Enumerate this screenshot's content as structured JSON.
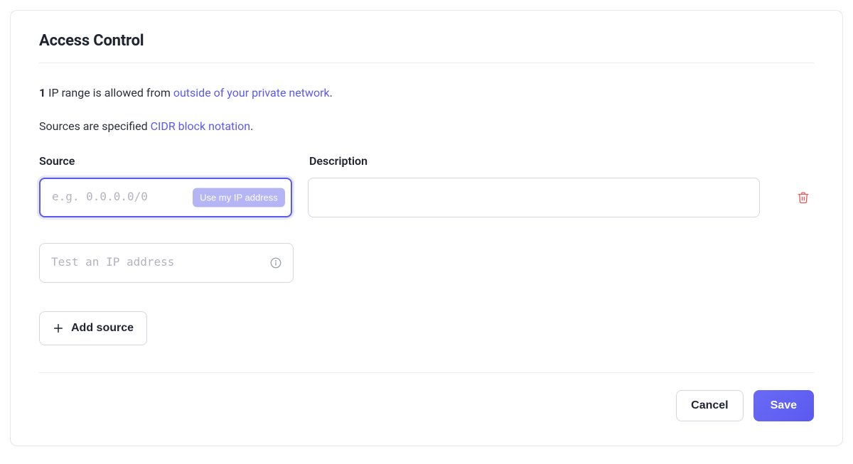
{
  "title": "Access Control",
  "summary": {
    "count": "1",
    "text_before": " IP range is allowed from ",
    "link_text": "outside of your private network",
    "text_after": "."
  },
  "cidr_line": {
    "text_before": "Sources are specified ",
    "link_text": "CIDR block notation",
    "text_after": "."
  },
  "labels": {
    "source": "Source",
    "description": "Description"
  },
  "source_row": {
    "source_placeholder": "e.g. 0.0.0.0/0",
    "source_value": "",
    "use_my_ip_label": "Use my IP address",
    "description_value": ""
  },
  "test_ip": {
    "placeholder": "Test an IP address",
    "value": ""
  },
  "buttons": {
    "add_source": "Add source",
    "cancel": "Cancel",
    "save": "Save"
  }
}
